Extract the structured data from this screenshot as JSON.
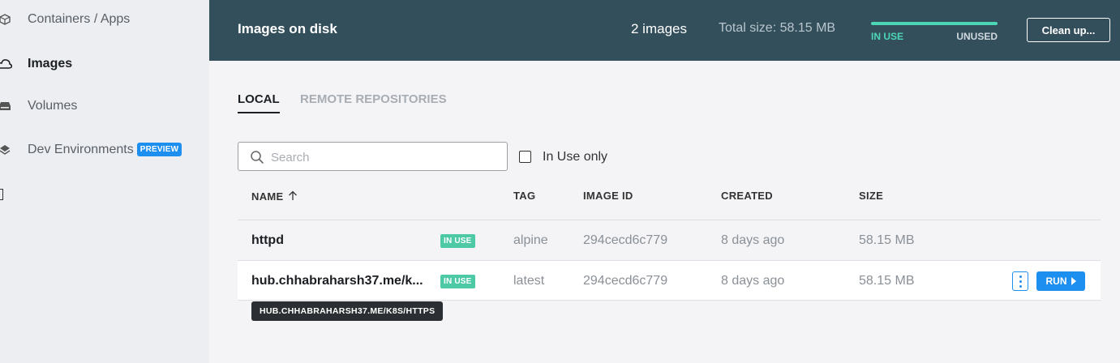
{
  "sidebar": {
    "items": [
      {
        "label": "Containers / Apps",
        "icon": "containers-icon"
      },
      {
        "label": "Images",
        "icon": "cloud-icon"
      },
      {
        "label": "Volumes",
        "icon": "drive-icon"
      },
      {
        "label": "Dev Environments",
        "icon": "layers-icon",
        "badge": "PREVIEW"
      }
    ]
  },
  "header": {
    "title": "Images on disk",
    "count": "2 images",
    "total_size": "Total size: 58.15 MB",
    "usage": {
      "in_use_label": "IN USE",
      "unused_label": "UNUSED",
      "in_use_fraction": 1.0
    },
    "cleanup_label": "Clean up...",
    "bg_color": "#344f5c",
    "accent_color": "#4dd6b6"
  },
  "tabs": [
    {
      "label": "LOCAL",
      "active": true
    },
    {
      "label": "REMOTE REPOSITORIES",
      "active": false
    }
  ],
  "search": {
    "placeholder": "Search",
    "value": ""
  },
  "filter": {
    "label": "In Use only",
    "checked": false
  },
  "table": {
    "columns": [
      "NAME",
      "TAG",
      "IMAGE ID",
      "CREATED",
      "SIZE"
    ],
    "sort_column": "NAME",
    "rows": [
      {
        "name": "httpd",
        "status": "IN USE",
        "tag": "alpine",
        "image_id": "294cecd6c779",
        "created": "8 days ago",
        "size": "58.15 MB"
      },
      {
        "name": "hub.chhabraharsh37.me/k...",
        "status": "IN USE",
        "tag": "latest",
        "image_id": "294cecd6c779",
        "created": "8 days ago",
        "size": "58.15 MB",
        "run_label": "RUN"
      }
    ]
  },
  "tooltip": "HUB.CHHABRAHARSH37.ME/K8S/HTTPS"
}
